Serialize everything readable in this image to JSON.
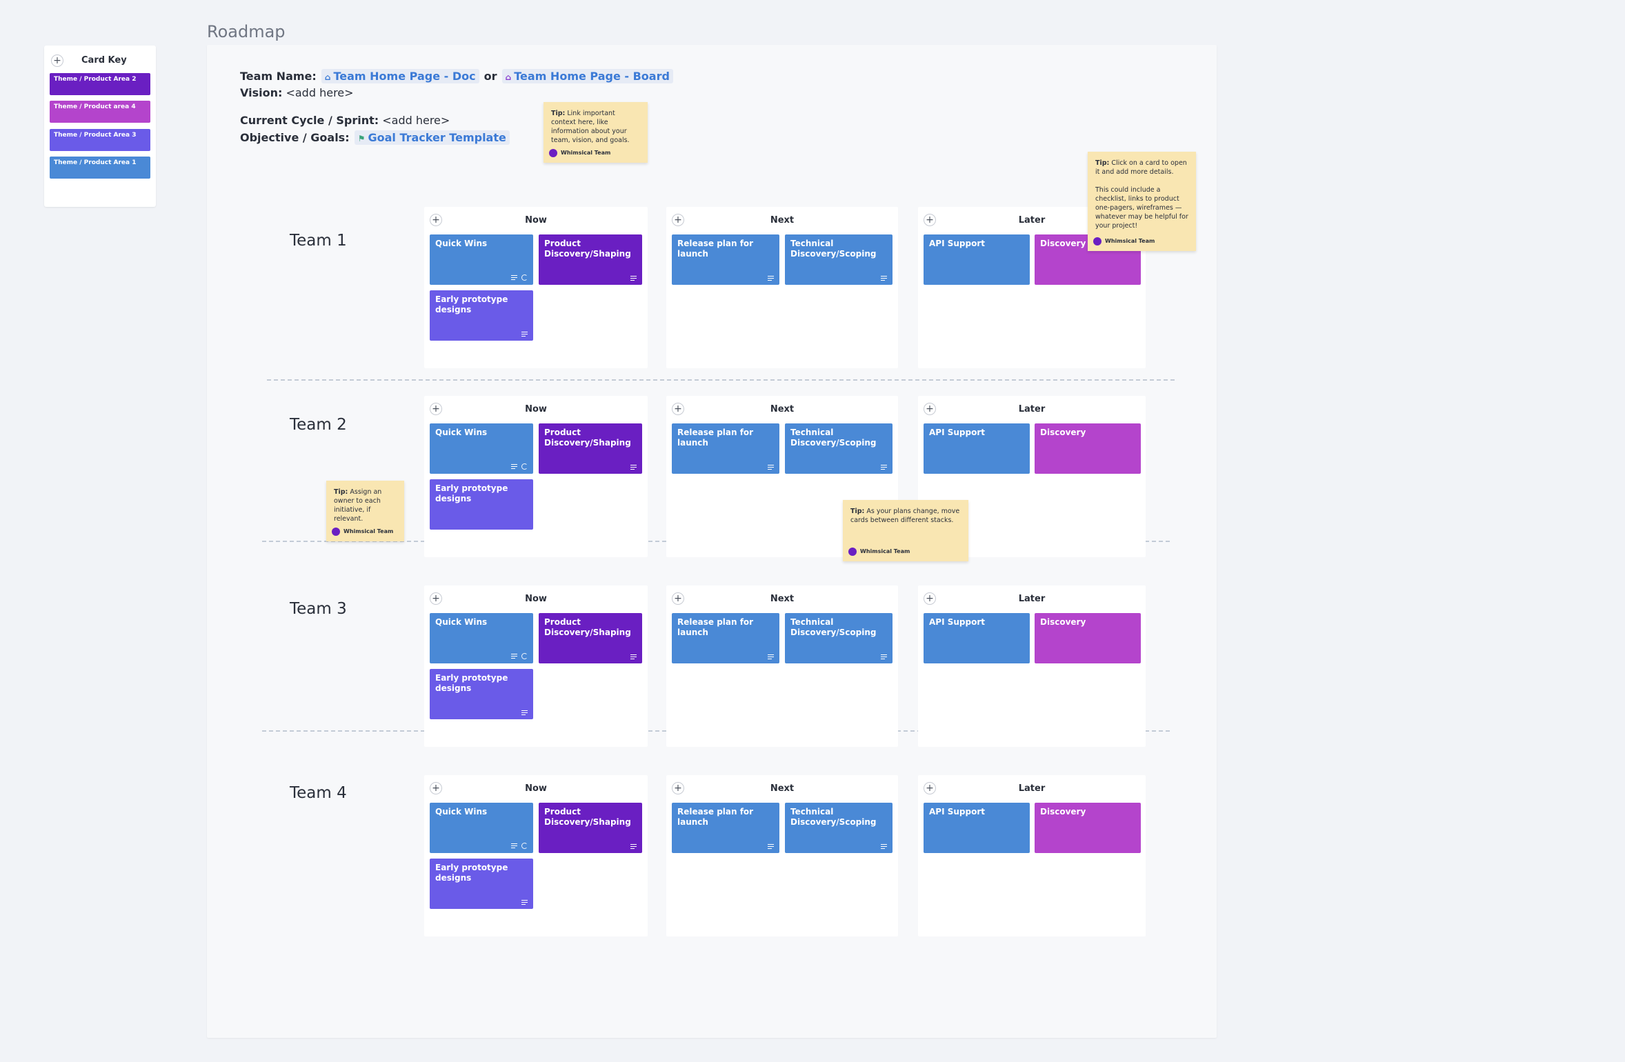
{
  "board": {
    "title": "Roadmap"
  },
  "card_key": {
    "title": "Card Key",
    "themes": [
      {
        "label": "Theme / Product Area 2",
        "color": "#6a1fc2"
      },
      {
        "label": "Theme / Product area 4",
        "color": "#b444cc"
      },
      {
        "label": "Theme / Product Area 3",
        "color": "#6a5be8"
      },
      {
        "label": "Theme / Product Area 1",
        "color": "#4a89d6"
      }
    ]
  },
  "info": {
    "team_name_label": "Team Name:",
    "team_doc_link": "Team Home Page - Doc",
    "or_text": "or",
    "team_board_link": "Team Home Page - Board",
    "vision_label": "Vision:",
    "vision_value": "<add here>",
    "cycle_label": "Current Cycle / Sprint:",
    "cycle_value": "<add here>",
    "objective_label": "Objective / Goals:",
    "goal_link": "Goal Tracker Template"
  },
  "stickies": {
    "context": {
      "tip": "Tip:",
      "text": "Link important context here, like information about your team, vision, and goals.",
      "author": "Whimsical Team"
    },
    "click": {
      "tip": "Tip:",
      "text": "Click on a card to open it and add more details.",
      "text2": "This could include a checklist, links to product one-pagers, wireframes — whatever may be helpful for your project!",
      "author": "Whimsical Team"
    },
    "owner": {
      "tip": "Tip:",
      "text": "Assign an owner to each initiative, if relevant.",
      "author": "Whimsical Team"
    },
    "move": {
      "tip": "Tip:",
      "text": "As your plans change, move cards between different stacks.",
      "author": "Whimsical Team"
    }
  },
  "columns": {
    "now": "Now",
    "next": "Next",
    "later": "Later"
  },
  "cards": {
    "quick_wins": "Quick Wins",
    "product_discovery": "Product Discovery/Shaping",
    "early_prototype": "Early prototype designs",
    "release_plan": "Release plan for launch",
    "technical_discovery": "Technical Discovery/Scoping",
    "api_support": "API Support",
    "discovery": "Discovery"
  },
  "teams": [
    {
      "name": "Team 1"
    },
    {
      "name": "Team 2"
    },
    {
      "name": "Team 3"
    },
    {
      "name": "Team 4"
    }
  ],
  "colors": {
    "blue": "#4a89d6",
    "purple": "#6a1fc2",
    "indigo": "#6a5be8",
    "magenta": "#b444cc",
    "sticky": "#f9e6b2"
  }
}
